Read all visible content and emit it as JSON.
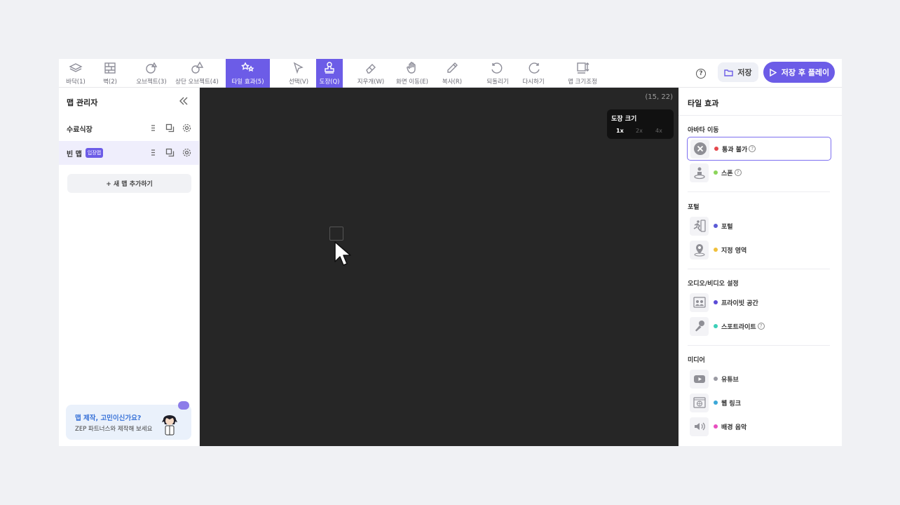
{
  "toolbar": {
    "tools": [
      {
        "label": "바닥(1)",
        "icon": "floor-layers-icon"
      },
      {
        "label": "벽(2)",
        "icon": "wall-icon"
      },
      {
        "label": "오브젝트(3)",
        "icon": "object-icon"
      },
      {
        "label": "상단 오브젝트(4)",
        "icon": "top-object-icon"
      },
      {
        "label": "타일 효과(5)",
        "icon": "tile-effect-icon",
        "active": true
      },
      {
        "label": "선택(V)",
        "icon": "select-cursor-icon"
      },
      {
        "label": "도장(Q)",
        "icon": "stamp-icon",
        "active": true
      },
      {
        "label": "지우개(W)",
        "icon": "eraser-icon"
      },
      {
        "label": "화면 이동(E)",
        "icon": "hand-icon"
      },
      {
        "label": "복사(R)",
        "icon": "eyedropper-icon"
      },
      {
        "label": "되돌리기",
        "icon": "undo-icon"
      },
      {
        "label": "다시하기",
        "icon": "redo-icon"
      },
      {
        "label": "맵 크기조정",
        "icon": "resize-map-icon"
      }
    ],
    "help_symbol": "?",
    "save_label": "저장",
    "save_play_label": "저장 후 플레이"
  },
  "left_panel": {
    "title": "맵 관리자",
    "maps": [
      {
        "name": "수료식장"
      },
      {
        "name": "빈 맵",
        "badge": "입장맵",
        "selected": true
      }
    ],
    "add_map_label": "+ 새 맵 추가하기",
    "promo": {
      "title": "맵 제작, 고민이신가요?",
      "subtitle": "ZEP 파트너스와 제작해 보세요"
    }
  },
  "canvas": {
    "coords": "(15, 22)",
    "stamp_size": {
      "title": "도장 크기",
      "options": [
        "1x",
        "2x",
        "4x"
      ],
      "selected": "1x"
    }
  },
  "right_panel": {
    "title": "타일 효과",
    "help_symbol": "?",
    "sections": [
      {
        "title": "아바타 이동",
        "items": [
          {
            "name": "통과 불가",
            "dot_color": "#e5484d",
            "icon": "impassable-x-icon",
            "help": true,
            "selected": true
          },
          {
            "name": "스폰",
            "dot_color": "#8bd55a",
            "icon": "spawn-icon",
            "help": true
          }
        ]
      },
      {
        "title": "포털",
        "items": [
          {
            "name": "포털",
            "dot_color": "#5b5bd6",
            "icon": "portal-runner-icon"
          },
          {
            "name": "지정 영역",
            "dot_color": "#f0c03c",
            "icon": "location-pin-icon"
          }
        ]
      },
      {
        "title": "오디오/비디오 설정",
        "items": [
          {
            "name": "프라이빗 공간",
            "dot_color": "#5b4bd6",
            "icon": "private-space-icon"
          },
          {
            "name": "스포트라이트",
            "dot_color": "#3ccfb8",
            "icon": "microphone-icon",
            "help": true
          }
        ]
      },
      {
        "title": "미디어",
        "items": [
          {
            "name": "유튜브",
            "dot_color": "#9a9aa3",
            "icon": "youtube-icon"
          },
          {
            "name": "웹 링크",
            "dot_color": "#3ba7d8",
            "icon": "web-link-icon"
          },
          {
            "name": "배경 음악",
            "dot_color": "#e84fbf",
            "icon": "speaker-icon"
          }
        ]
      }
    ]
  }
}
